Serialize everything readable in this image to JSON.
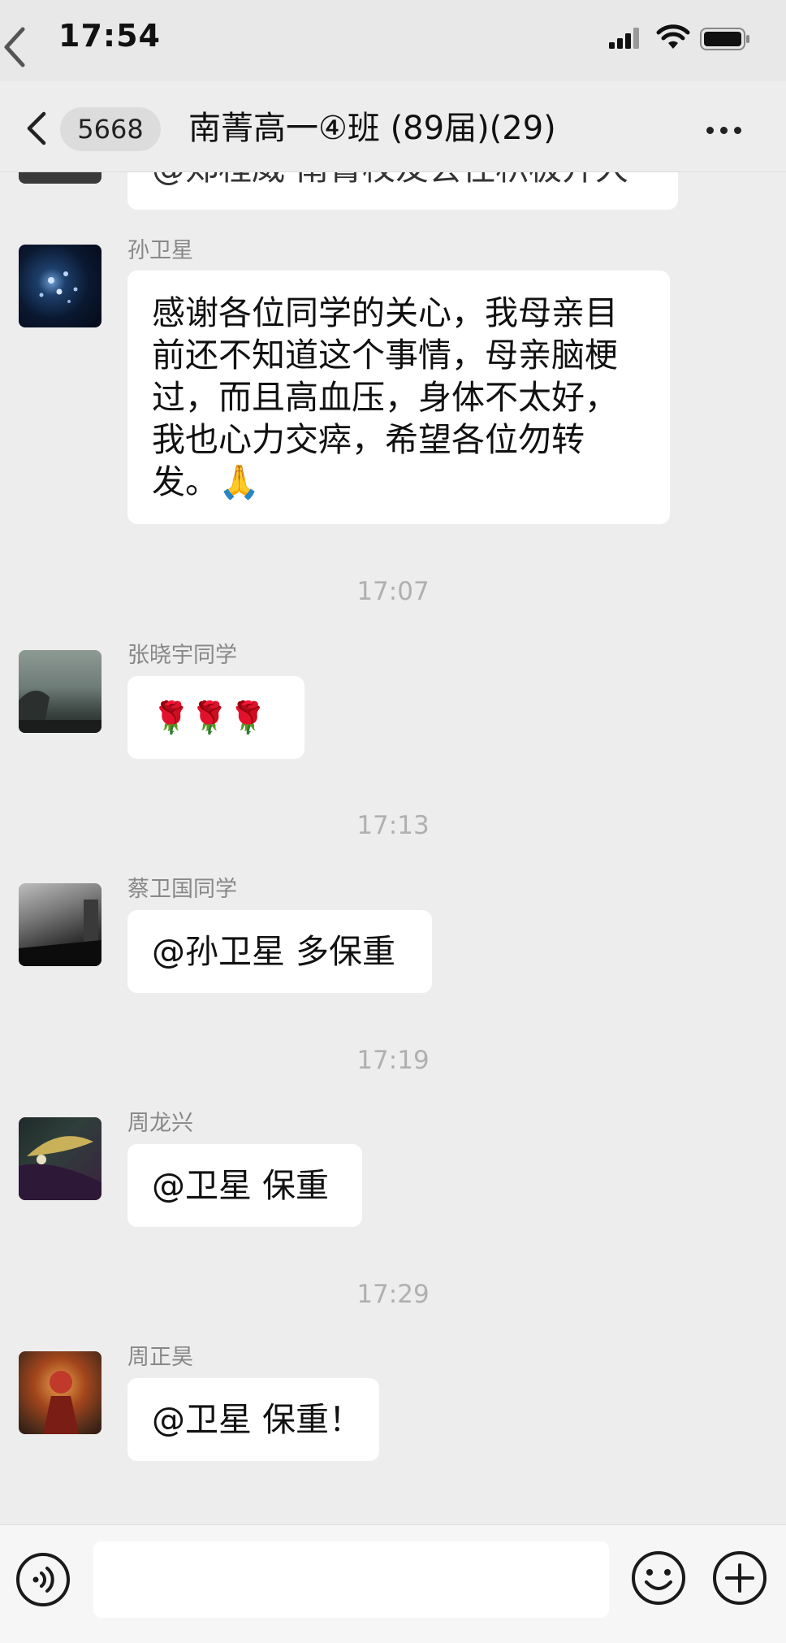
{
  "status_bar": {
    "time": "17:54"
  },
  "nav": {
    "unread_count": "5668",
    "title": "南菁高一④班 (89届)(29)"
  },
  "partial_message": {
    "text": "@郑程威 南菁校友会往积极开大"
  },
  "messages": [
    {
      "sender": "孙卫星",
      "lines": [
        "感谢各位同学的关心，我母亲目",
        "前还不知道这个事情，母亲脑梗",
        "过，而且高血压，身体不太好，",
        "我也心力交瘁，希望各位勿转",
        "发。🙏"
      ]
    },
    {
      "time": "17:07",
      "sender": "张晓宇同学",
      "text": "🌹🌹🌹"
    },
    {
      "time": "17:13",
      "sender": "蔡卫国同学",
      "text": "@孙卫星 多保重"
    },
    {
      "time": "17:19",
      "sender": "周龙兴",
      "text": "@卫星 保重"
    },
    {
      "time": "17:29",
      "sender": "周正昊",
      "text": "@卫星 保重！"
    }
  ],
  "icons": {
    "voice": "voice-icon",
    "emoji": "emoji-icon",
    "plus": "plus-icon"
  },
  "colors": {
    "background": "#ededed",
    "bubble": "#ffffff",
    "timestamp": "#b0b0b0",
    "sender": "#888888"
  }
}
